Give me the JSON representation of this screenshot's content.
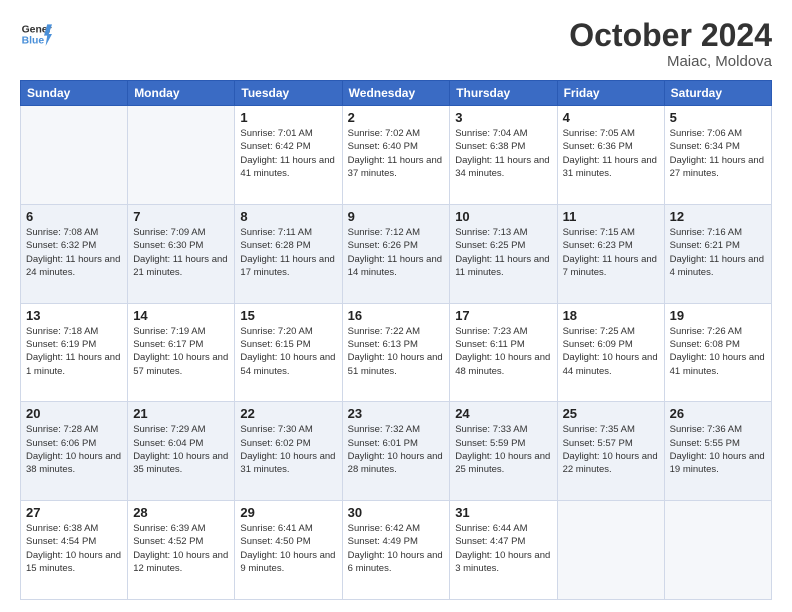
{
  "header": {
    "logo_general": "General",
    "logo_blue": "Blue",
    "month": "October 2024",
    "location": "Maiac, Moldova"
  },
  "weekdays": [
    "Sunday",
    "Monday",
    "Tuesday",
    "Wednesday",
    "Thursday",
    "Friday",
    "Saturday"
  ],
  "weeks": [
    [
      {
        "day": "",
        "sunrise": "",
        "sunset": "",
        "daylight": ""
      },
      {
        "day": "",
        "sunrise": "",
        "sunset": "",
        "daylight": ""
      },
      {
        "day": "1",
        "sunrise": "Sunrise: 7:01 AM",
        "sunset": "Sunset: 6:42 PM",
        "daylight": "Daylight: 11 hours and 41 minutes."
      },
      {
        "day": "2",
        "sunrise": "Sunrise: 7:02 AM",
        "sunset": "Sunset: 6:40 PM",
        "daylight": "Daylight: 11 hours and 37 minutes."
      },
      {
        "day": "3",
        "sunrise": "Sunrise: 7:04 AM",
        "sunset": "Sunset: 6:38 PM",
        "daylight": "Daylight: 11 hours and 34 minutes."
      },
      {
        "day": "4",
        "sunrise": "Sunrise: 7:05 AM",
        "sunset": "Sunset: 6:36 PM",
        "daylight": "Daylight: 11 hours and 31 minutes."
      },
      {
        "day": "5",
        "sunrise": "Sunrise: 7:06 AM",
        "sunset": "Sunset: 6:34 PM",
        "daylight": "Daylight: 11 hours and 27 minutes."
      }
    ],
    [
      {
        "day": "6",
        "sunrise": "Sunrise: 7:08 AM",
        "sunset": "Sunset: 6:32 PM",
        "daylight": "Daylight: 11 hours and 24 minutes."
      },
      {
        "day": "7",
        "sunrise": "Sunrise: 7:09 AM",
        "sunset": "Sunset: 6:30 PM",
        "daylight": "Daylight: 11 hours and 21 minutes."
      },
      {
        "day": "8",
        "sunrise": "Sunrise: 7:11 AM",
        "sunset": "Sunset: 6:28 PM",
        "daylight": "Daylight: 11 hours and 17 minutes."
      },
      {
        "day": "9",
        "sunrise": "Sunrise: 7:12 AM",
        "sunset": "Sunset: 6:26 PM",
        "daylight": "Daylight: 11 hours and 14 minutes."
      },
      {
        "day": "10",
        "sunrise": "Sunrise: 7:13 AM",
        "sunset": "Sunset: 6:25 PM",
        "daylight": "Daylight: 11 hours and 11 minutes."
      },
      {
        "day": "11",
        "sunrise": "Sunrise: 7:15 AM",
        "sunset": "Sunset: 6:23 PM",
        "daylight": "Daylight: 11 hours and 7 minutes."
      },
      {
        "day": "12",
        "sunrise": "Sunrise: 7:16 AM",
        "sunset": "Sunset: 6:21 PM",
        "daylight": "Daylight: 11 hours and 4 minutes."
      }
    ],
    [
      {
        "day": "13",
        "sunrise": "Sunrise: 7:18 AM",
        "sunset": "Sunset: 6:19 PM",
        "daylight": "Daylight: 11 hours and 1 minute."
      },
      {
        "day": "14",
        "sunrise": "Sunrise: 7:19 AM",
        "sunset": "Sunset: 6:17 PM",
        "daylight": "Daylight: 10 hours and 57 minutes."
      },
      {
        "day": "15",
        "sunrise": "Sunrise: 7:20 AM",
        "sunset": "Sunset: 6:15 PM",
        "daylight": "Daylight: 10 hours and 54 minutes."
      },
      {
        "day": "16",
        "sunrise": "Sunrise: 7:22 AM",
        "sunset": "Sunset: 6:13 PM",
        "daylight": "Daylight: 10 hours and 51 minutes."
      },
      {
        "day": "17",
        "sunrise": "Sunrise: 7:23 AM",
        "sunset": "Sunset: 6:11 PM",
        "daylight": "Daylight: 10 hours and 48 minutes."
      },
      {
        "day": "18",
        "sunrise": "Sunrise: 7:25 AM",
        "sunset": "Sunset: 6:09 PM",
        "daylight": "Daylight: 10 hours and 44 minutes."
      },
      {
        "day": "19",
        "sunrise": "Sunrise: 7:26 AM",
        "sunset": "Sunset: 6:08 PM",
        "daylight": "Daylight: 10 hours and 41 minutes."
      }
    ],
    [
      {
        "day": "20",
        "sunrise": "Sunrise: 7:28 AM",
        "sunset": "Sunset: 6:06 PM",
        "daylight": "Daylight: 10 hours and 38 minutes."
      },
      {
        "day": "21",
        "sunrise": "Sunrise: 7:29 AM",
        "sunset": "Sunset: 6:04 PM",
        "daylight": "Daylight: 10 hours and 35 minutes."
      },
      {
        "day": "22",
        "sunrise": "Sunrise: 7:30 AM",
        "sunset": "Sunset: 6:02 PM",
        "daylight": "Daylight: 10 hours and 31 minutes."
      },
      {
        "day": "23",
        "sunrise": "Sunrise: 7:32 AM",
        "sunset": "Sunset: 6:01 PM",
        "daylight": "Daylight: 10 hours and 28 minutes."
      },
      {
        "day": "24",
        "sunrise": "Sunrise: 7:33 AM",
        "sunset": "Sunset: 5:59 PM",
        "daylight": "Daylight: 10 hours and 25 minutes."
      },
      {
        "day": "25",
        "sunrise": "Sunrise: 7:35 AM",
        "sunset": "Sunset: 5:57 PM",
        "daylight": "Daylight: 10 hours and 22 minutes."
      },
      {
        "day": "26",
        "sunrise": "Sunrise: 7:36 AM",
        "sunset": "Sunset: 5:55 PM",
        "daylight": "Daylight: 10 hours and 19 minutes."
      }
    ],
    [
      {
        "day": "27",
        "sunrise": "Sunrise: 6:38 AM",
        "sunset": "Sunset: 4:54 PM",
        "daylight": "Daylight: 10 hours and 15 minutes."
      },
      {
        "day": "28",
        "sunrise": "Sunrise: 6:39 AM",
        "sunset": "Sunset: 4:52 PM",
        "daylight": "Daylight: 10 hours and 12 minutes."
      },
      {
        "day": "29",
        "sunrise": "Sunrise: 6:41 AM",
        "sunset": "Sunset: 4:50 PM",
        "daylight": "Daylight: 10 hours and 9 minutes."
      },
      {
        "day": "30",
        "sunrise": "Sunrise: 6:42 AM",
        "sunset": "Sunset: 4:49 PM",
        "daylight": "Daylight: 10 hours and 6 minutes."
      },
      {
        "day": "31",
        "sunrise": "Sunrise: 6:44 AM",
        "sunset": "Sunset: 4:47 PM",
        "daylight": "Daylight: 10 hours and 3 minutes."
      },
      {
        "day": "",
        "sunrise": "",
        "sunset": "",
        "daylight": ""
      },
      {
        "day": "",
        "sunrise": "",
        "sunset": "",
        "daylight": ""
      }
    ]
  ]
}
